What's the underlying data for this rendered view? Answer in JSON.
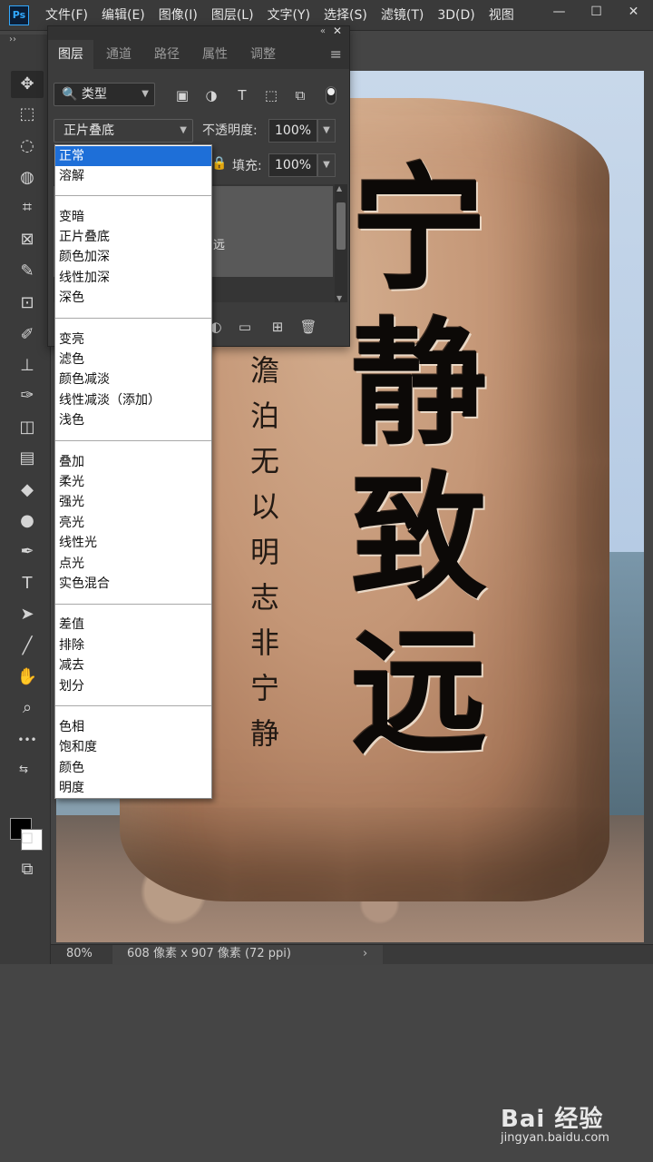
{
  "menubar": {
    "logo": "Ps",
    "items": [
      "文件(F)",
      "编辑(E)",
      "图像(I)",
      "图层(L)",
      "文字(Y)",
      "选择(S)",
      "滤镜(T)",
      "3D(D)",
      "视图"
    ],
    "controls": [
      "—",
      "☐",
      "✕"
    ]
  },
  "toolbar": {
    "collapse": "››",
    "tools": [
      "✥",
      "⬚",
      "◌",
      "◍",
      "⌗",
      "⊠",
      "✎",
      "⊡",
      "✐",
      "⊥",
      "✑",
      "◫",
      "▤",
      "◆",
      "●",
      "✒",
      "T",
      "➤",
      "╱",
      "✋",
      "⌕",
      "•••",
      "⇆",
      "◻",
      "⧉"
    ]
  },
  "panel": {
    "collapse": "«",
    "close": "✕",
    "tabs": [
      "图层",
      "通道",
      "路径",
      "属性",
      "调整"
    ],
    "menu_icon": "≡",
    "filter_label": "🔍 类型",
    "filter_icons": [
      "▣",
      "◑",
      "T",
      "⬚",
      "⧉"
    ],
    "blend_mode": "正片叠底",
    "opacity_label": "不透明度:",
    "opacity_value": "100%",
    "lock_icon": "🔒",
    "fill_label": "填充:",
    "fill_value": "100%",
    "layer_name": "远",
    "bottom_icons": [
      "◐",
      "▭",
      "⊞",
      "🗑"
    ]
  },
  "blend_options": [
    [
      "正常",
      "溶解"
    ],
    [
      "变暗",
      "正片叠底",
      "颜色加深",
      "线性加深",
      "深色"
    ],
    [
      "变亮",
      "滤色",
      "颜色减淡",
      "线性减淡（添加）",
      "浅色"
    ],
    [
      "叠加",
      "柔光",
      "强光",
      "亮光",
      "线性光",
      "点光",
      "实色混合"
    ],
    [
      "差值",
      "排除",
      "减去",
      "划分"
    ],
    [
      "色相",
      "饱和度",
      "颜色",
      "明度"
    ]
  ],
  "selected_option": "正常",
  "canvas": {
    "big_chars": [
      "宁",
      "静",
      "致",
      "远"
    ],
    "small_chars": [
      "澹",
      "泊",
      "无",
      "以",
      "明",
      "志",
      "非",
      "宁",
      "静"
    ]
  },
  "status": {
    "zoom": "80%",
    "doc_info": "608 像素 x 907 像素 (72 ppi)",
    "arrow": "›"
  },
  "watermark": {
    "brand": "Bai 经验",
    "url": "jingyan.baidu.com"
  },
  "colors": {
    "selection": "#1e6fd8",
    "ps_blue": "#31a8ff"
  }
}
